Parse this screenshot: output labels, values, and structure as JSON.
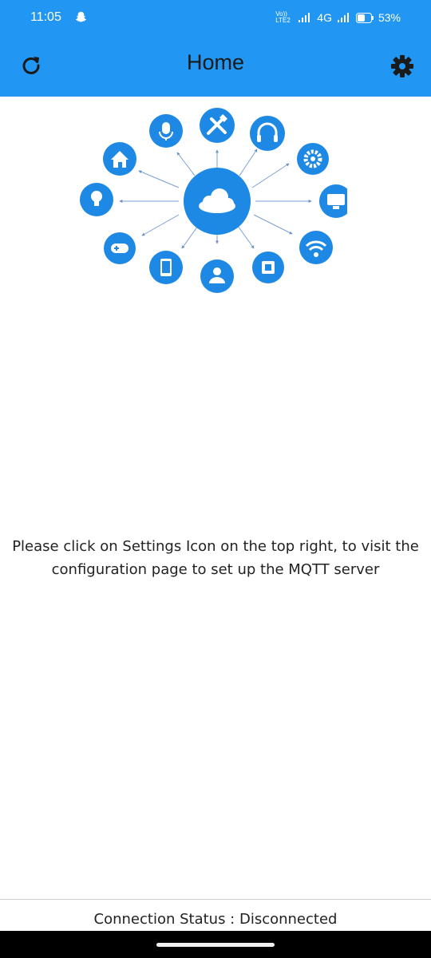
{
  "status_bar": {
    "time": "11:05",
    "network_label": "Vo)) LTE2",
    "network_type": "4G",
    "battery": "53%"
  },
  "app_bar": {
    "title": "Home",
    "left_icon": "refresh-icon",
    "right_icon": "gear-icon",
    "background_color": "#2196F3"
  },
  "hero": {
    "center_icon": "cloud-icon",
    "device_icons": [
      "tools-icon",
      "headphones-icon",
      "gear-icon",
      "monitor-icon",
      "wifi-icon",
      "chip-icon",
      "person-icon",
      "phone-icon",
      "gamepad-icon",
      "bulb-icon",
      "home-icon",
      "microphone-icon"
    ],
    "accent_color": "#1E88E5"
  },
  "main": {
    "message": "Please click on Settings Icon on the top right, to visit the configuration page to set up the MQTT server"
  },
  "footer": {
    "connection_status": "Connection Status : Disconnected"
  }
}
